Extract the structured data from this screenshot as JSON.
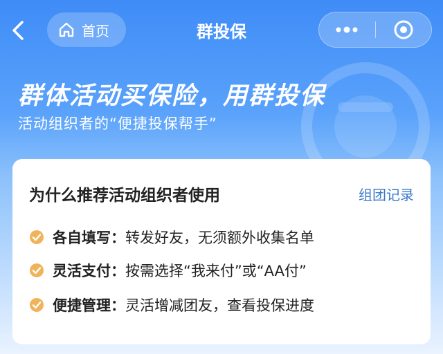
{
  "nav": {
    "home_label": "首页",
    "title": "群投保"
  },
  "hero": {
    "title": "群体活动买保险，用群投保",
    "subtitle": "活动组织者的“便捷投保帮手”"
  },
  "card": {
    "title": "为什么推荐活动组织者使用",
    "link": "组团记录",
    "features": [
      {
        "name": "各自填写：",
        "desc": "转发好友，无须额外收集名单"
      },
      {
        "name": "灵活支付：",
        "desc": "按需选择“我来付”或“AA付”"
      },
      {
        "name": "便捷管理：",
        "desc": "灵活增减团友，查看投保进度"
      }
    ]
  },
  "colors": {
    "accent_blue": "#3f8cf7",
    "link_blue": "#3a78c8",
    "check_orange": "#f0b35a"
  },
  "icons": [
    "back-icon",
    "home-icon",
    "more-icon",
    "target-icon",
    "check-icon"
  ]
}
